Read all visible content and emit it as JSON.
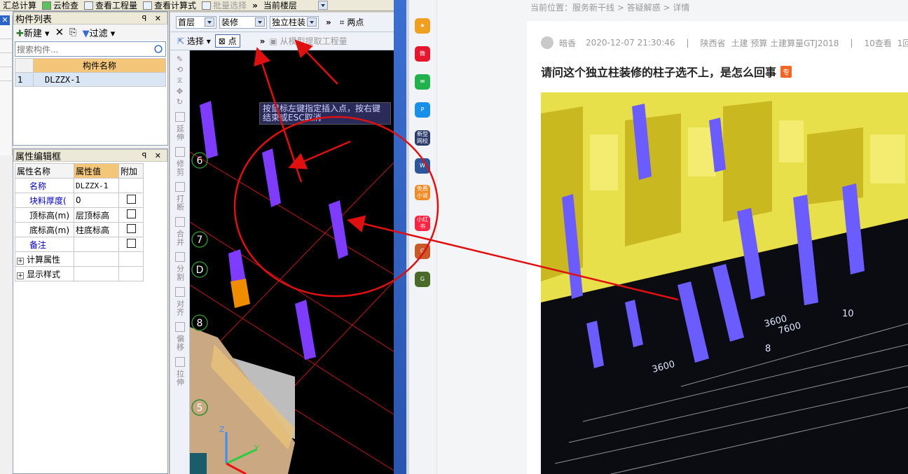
{
  "cad": {
    "topbar": {
      "summary": "汇总计算",
      "cloud_check": "云检查",
      "view_quantity": "查看工程量",
      "view_formula": "查看计算式",
      "batch_select": "批量选择",
      "more": "»",
      "current_floor": "当前楼层"
    },
    "component_list": {
      "title": "构件列表",
      "pin": "ꟼ ✕",
      "new_label": "新建",
      "filter_label": "过滤",
      "search_placeholder": "搜索构件...",
      "column": "构件名称",
      "rows": [
        {
          "index": "1",
          "name": "DLZZX-1"
        }
      ]
    },
    "property_editor": {
      "title": "属性编辑框",
      "columns": [
        "属性名称",
        "属性值",
        "附加"
      ],
      "rows": [
        {
          "name": "名称",
          "value": "DLZZX-1",
          "checkbox": false
        },
        {
          "name": "块料厚度(",
          "value": "0",
          "checkbox": true
        },
        {
          "name": "顶标高(m)",
          "value": "层顶标高",
          "checkbox": true
        },
        {
          "name": "底标高(m)",
          "value": "柱底标高",
          "checkbox": true
        },
        {
          "name": "备注",
          "value": "",
          "checkbox": true
        }
      ],
      "groups": [
        "计算属性",
        "显示样式"
      ]
    },
    "toolbar1": {
      "floor": "首层",
      "category": "装修",
      "component": "独立柱装",
      "more": "»",
      "two_point": "两点"
    },
    "toolbar2": {
      "select": "选择",
      "point": "点",
      "more": "»",
      "extract": "从模型提取工程量"
    },
    "side_tools": [
      "延伸",
      "修剪",
      "打断",
      "合并",
      "分割",
      "对齐",
      "偏移",
      "拉伸"
    ],
    "tooltip": "按鼠标左键指定插入点，按右键结束或ESC取消",
    "axis_labels": [
      "6",
      "7",
      "D",
      "8",
      "5"
    ],
    "axes": {
      "z": "Z",
      "y": "Y"
    }
  },
  "browser": {
    "breadcrumb": "当前位置：服务新干线 > 答疑解惑 > 详情",
    "author": "暗香",
    "date": "2020-12-07 21:30:46",
    "region": "陕西省",
    "tags": "土建 预算 土建算量GTJ2018",
    "views": "10查看",
    "answers": "1回",
    "question_title": "请问这个独立柱装修的柱子选不上，是怎么回事",
    "question_tag": "专",
    "sidebar_icons": [
      {
        "name": "star",
        "label": "★",
        "color": "#f0a020"
      },
      {
        "name": "weibo",
        "label": "微",
        "color": "#e6162d"
      },
      {
        "name": "mail",
        "label": "✉",
        "color": "#22b14c"
      },
      {
        "name": "p-app",
        "label": "P",
        "color": "#1a8fe8"
      },
      {
        "name": "news",
        "label": "新型网校",
        "color": "#2b3b6b"
      },
      {
        "name": "doc",
        "label": "W",
        "color": "#2b579a"
      },
      {
        "name": "novel",
        "label": "免费小说",
        "color": "#f08a24"
      },
      {
        "name": "redbook",
        "label": "小红书",
        "color": "#ff2442"
      },
      {
        "name": "game1",
        "label": "G",
        "color": "#c85a2a"
      },
      {
        "name": "game2",
        "label": "G",
        "color": "#4a6a2a"
      }
    ],
    "photo_labels": [
      "3600",
      "7600",
      "10",
      "3600",
      "8"
    ]
  }
}
